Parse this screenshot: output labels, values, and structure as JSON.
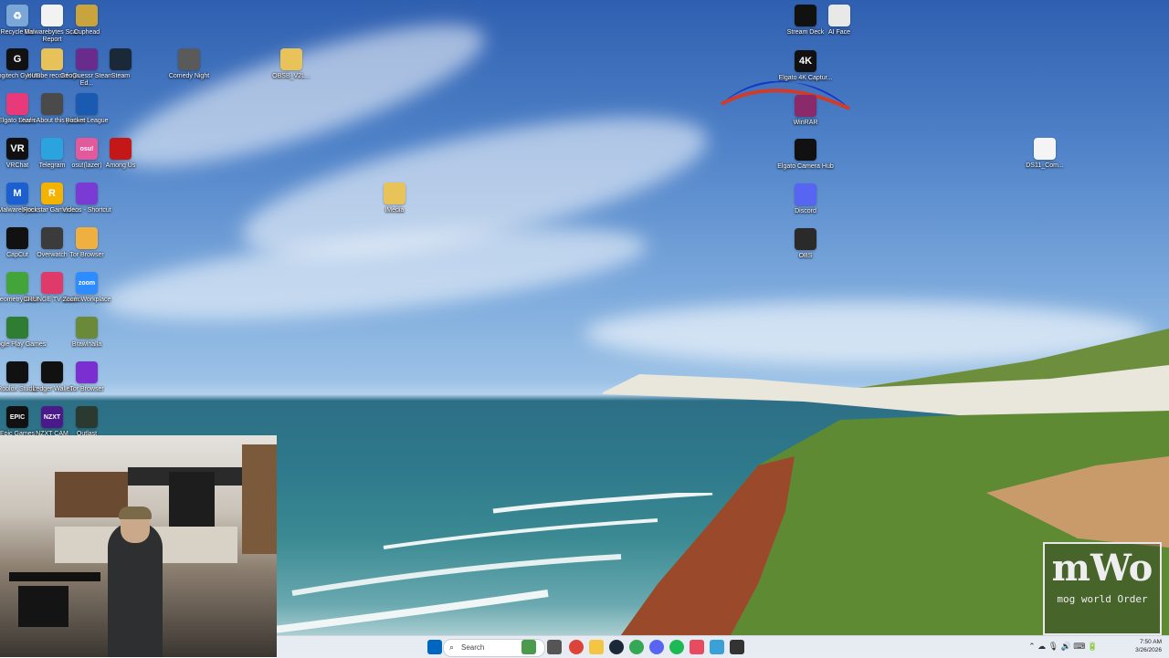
{
  "desktop": {
    "icons": [
      {
        "label": "Recycle Bin",
        "glyph": "♻",
        "color": "#7aa7d8"
      },
      {
        "label": "Malwarebytes Scan Report",
        "glyph": "",
        "color": "#f2f2f2"
      },
      {
        "label": "Cuphead",
        "glyph": "",
        "color": "#c9a43c"
      },
      {
        "label": "Logitech G HUB",
        "glyph": "G",
        "color": "#111111"
      },
      {
        "label": "youtube recordings",
        "glyph": "",
        "color": "#e7c15a"
      },
      {
        "label": "GeoGuessr Steam Ed...",
        "glyph": "",
        "color": "#6a2c8c"
      },
      {
        "label": "Steam",
        "glyph": "",
        "color": "#1b2838"
      },
      {
        "label": "Comedy Night",
        "glyph": "",
        "color": "#5a5a5a"
      },
      {
        "label": "OBSB_V2L...",
        "glyph": "",
        "color": "#e8c35a"
      },
      {
        "label": "Elgato Studio",
        "glyph": "",
        "color": "#e83a7a"
      },
      {
        "label": "Learn About this picture",
        "glyph": "",
        "color": "#4a4a4a"
      },
      {
        "label": "Rocket League",
        "glyph": "",
        "color": "#1a5ab0"
      },
      {
        "label": "VRChat",
        "glyph": "VR",
        "color": "#111111"
      },
      {
        "label": "Telegram",
        "glyph": "",
        "color": "#2aa3de"
      },
      {
        "label": "osu!(lazer)",
        "glyph": "osu!",
        "color": "#e35a9c"
      },
      {
        "label": "Among Us",
        "glyph": "",
        "color": "#c41818"
      },
      {
        "label": "Malwarebytes",
        "glyph": "M",
        "color": "#1b5fd1"
      },
      {
        "label": "Rockstar Games L...",
        "glyph": "R",
        "color": "#f4b300"
      },
      {
        "label": "Videos - Shortcut",
        "glyph": "",
        "color": "#7a3ad4"
      },
      {
        "label": "iMedia",
        "glyph": "",
        "color": "#e8c35a"
      },
      {
        "label": "CapCut",
        "glyph": "",
        "color": "#111111"
      },
      {
        "label": "Overwatch",
        "glyph": "",
        "color": "#3b3b3b"
      },
      {
        "label": "Tor Browser",
        "glyph": "",
        "color": "#f0b040"
      },
      {
        "label": "Geometry Dash",
        "glyph": "",
        "color": "#43a43a"
      },
      {
        "label": "GRUNGE TV Studio",
        "glyph": "",
        "color": "#e03a6a"
      },
      {
        "label": "Zoom Workplace",
        "glyph": "zoom",
        "color": "#2d8cff"
      },
      {
        "label": "Google Play Games",
        "glyph": "",
        "color": "#2e7d32"
      },
      {
        "label": "Brawlhalla",
        "glyph": "",
        "color": "#6a8a3a"
      },
      {
        "label": "Roblox Studio",
        "glyph": "",
        "color": "#111111"
      },
      {
        "label": "Ledger Wallet",
        "glyph": "",
        "color": "#111111"
      },
      {
        "label": "Tor Browser",
        "glyph": "",
        "color": "#7a2fd0"
      },
      {
        "label": "Epic Games",
        "glyph": "EPIC",
        "color": "#111111"
      },
      {
        "label": "NZXT CAM",
        "glyph": "NZXT",
        "color": "#4b1a8a"
      },
      {
        "label": "Outlast",
        "glyph": "",
        "color": "#2a3a30"
      },
      {
        "label": "Stream Deck",
        "glyph": "",
        "color": "#111111"
      },
      {
        "label": "AI Face",
        "glyph": "",
        "color": "#e8e8e8"
      },
      {
        "label": "Elgato 4K Captur...",
        "glyph": "4K",
        "color": "#111111"
      },
      {
        "label": "WinRAR",
        "glyph": "",
        "color": "#8a2a6a"
      },
      {
        "label": "Elgato Camera Hub",
        "glyph": "",
        "color": "#111111"
      },
      {
        "label": "Discord",
        "glyph": "",
        "color": "#5865f2"
      },
      {
        "label": "OBS",
        "glyph": "",
        "color": "#2a2a2a"
      },
      {
        "label": "DS11_Com...",
        "glyph": "",
        "color": "#f4f4f4"
      }
    ]
  },
  "taskbar": {
    "search_placeholder": "Search",
    "time": "7:50 AM",
    "date": "3/26/2026",
    "apps": [
      "start",
      "search",
      "widgets",
      "task-view",
      "chrome",
      "file-explorer",
      "steam",
      "chrome-2",
      "discord",
      "spotify",
      "store",
      "notepad",
      "terminal"
    ]
  },
  "watermark": {
    "line1": "mWo",
    "line2": "mog world Order"
  },
  "colors": {
    "taskbar_bg": "#e8ecf2",
    "accent": "#0067c0"
  }
}
